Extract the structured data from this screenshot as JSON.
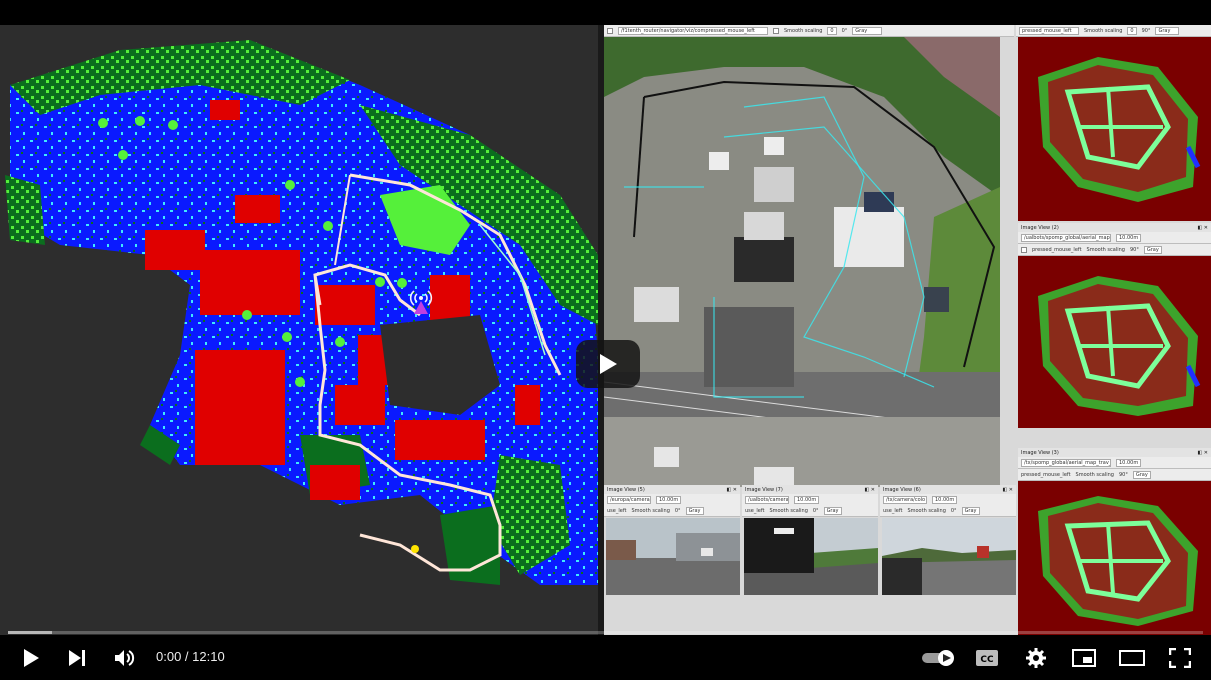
{
  "player": {
    "time_display": "0:00 / 12:10",
    "progress_fraction": 0.0
  },
  "desktop": {
    "top_toolbar": {
      "topic": "/f1tenth_router/navigator/viz/compressed_mouse_left",
      "smooth_label": "Smooth scaling",
      "value_a": "0",
      "value_b": "0°",
      "colormap": "Gray"
    },
    "right_toolbar": {
      "topic": "pressed_mouse_left",
      "smooth_label": "Smooth scaling",
      "value_a": "0",
      "value_b": "90°",
      "colormap": "Gray"
    },
    "image_view_2": {
      "title": "Image View (2)",
      "topic": "/ualbots/spomp_global/aerial_map_trav_viz",
      "value": "10.00m",
      "pressed": "pressed_mouse_left",
      "smooth_label": "Smooth scaling",
      "angle": "90°",
      "colormap": "Gray"
    },
    "image_view_3": {
      "title": "Image View (3)",
      "topic": "/tx/spomp_global/aerial_map_trav_viz/com",
      "value": "10.00m",
      "pressed": "pressed_mouse_left",
      "smooth_label": "Smooth scaling",
      "angle": "90°",
      "colormap": "Gray"
    },
    "image_view_5": {
      "title": "Image View (5)",
      "topic": "/europa/camera/",
      "value": "10.00m",
      "pressed": "use_left",
      "smooth_label": "Smooth scaling",
      "angle": "0°",
      "colormap": "Gray"
    },
    "image_view_7": {
      "title": "Image View (7)",
      "topic": "/ualbots/camera/",
      "value": "10.00m",
      "pressed": "use_left",
      "smooth_label": "Smooth scaling",
      "angle": "0°",
      "colormap": "Gray"
    },
    "image_view_6": {
      "title": "Image View (6)",
      "topic": "/tx/camera/colo",
      "value": "10.00m",
      "pressed": "use_left",
      "smooth_label": "Smooth scaling",
      "angle": "0°",
      "colormap": "Gray"
    }
  },
  "colors": {
    "map_background": "#2d2d2d",
    "traversable": "#0a1aff",
    "obstacle": "#e00000",
    "vegetation_dark": "#0b6e1e",
    "vegetation_light": "#55f03a",
    "edge_cyan": "#3fe8ff",
    "path": "#ffe6d8"
  },
  "icons": {
    "play": "play-icon",
    "next": "next-icon",
    "volume": "volume-icon",
    "autoplay": "autoplay-toggle-icon",
    "captions": "cc-icon",
    "settings": "gear-icon",
    "miniplayer": "miniplayer-icon",
    "theater": "theater-icon",
    "fullscreen": "fullscreen-icon",
    "robot": "robot-marker-icon"
  }
}
